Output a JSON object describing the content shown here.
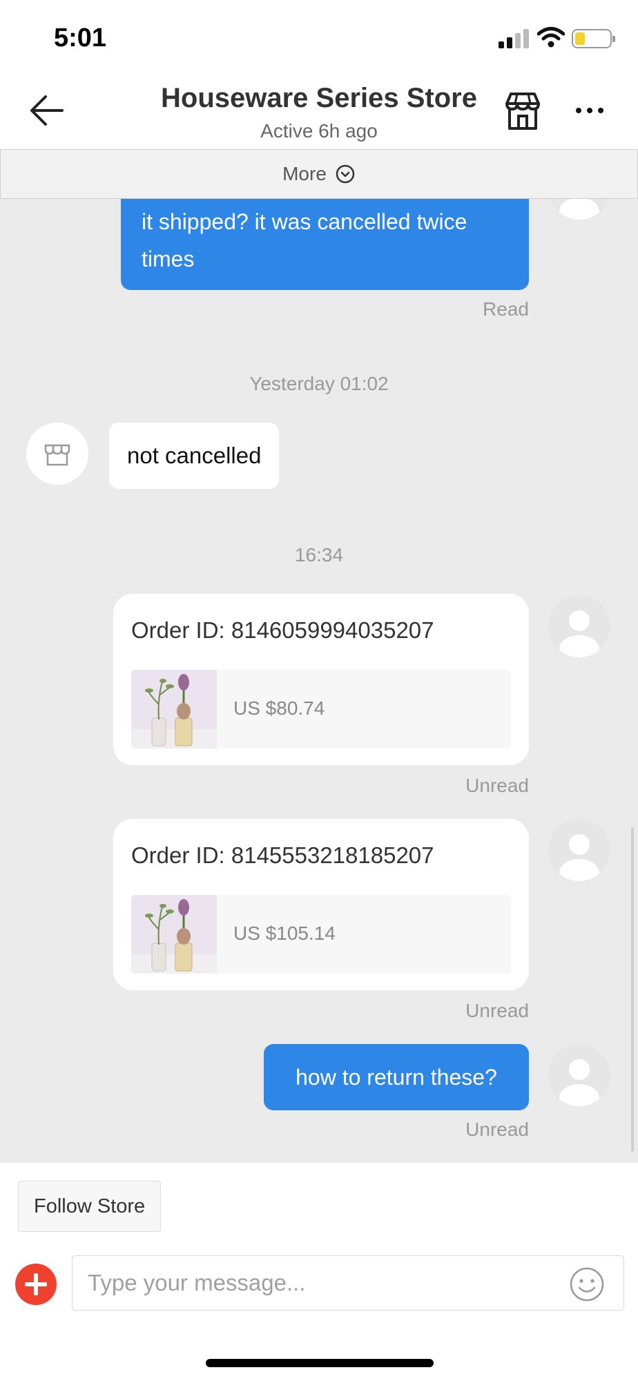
{
  "status_bar": {
    "time": "5:01"
  },
  "header": {
    "title": "Houseware Series Store",
    "status": "Active 6h ago",
    "icons": {
      "back": "back-arrow-icon",
      "store": "store-icon",
      "more": "more-dots-icon"
    }
  },
  "more_bar": {
    "label": "More",
    "icon": "chevron-down-circle-icon"
  },
  "messages": {
    "m1": {
      "text_line1": "it shipped? it was cancelled twice",
      "text_line2": "times",
      "status": "Read"
    },
    "time1": "Yesterday 01:02",
    "m2": {
      "text": "not cancelled"
    },
    "time2": "16:34",
    "order1": {
      "order_id": "Order ID: 8146059994035207",
      "price": "US $80.74",
      "status": "Unread"
    },
    "order2": {
      "order_id": "Order ID: 8145553218185207",
      "price": "US $105.14",
      "status": "Unread"
    },
    "m3": {
      "text": "how to return these?",
      "status": "Unread"
    }
  },
  "bottom": {
    "follow_label": "Follow Store",
    "input_placeholder": "Type your message...",
    "input_value": ""
  },
  "colors": {
    "accent": "#2e86e6",
    "add_button": "#f0412e",
    "chat_bg": "#ebebeb"
  }
}
